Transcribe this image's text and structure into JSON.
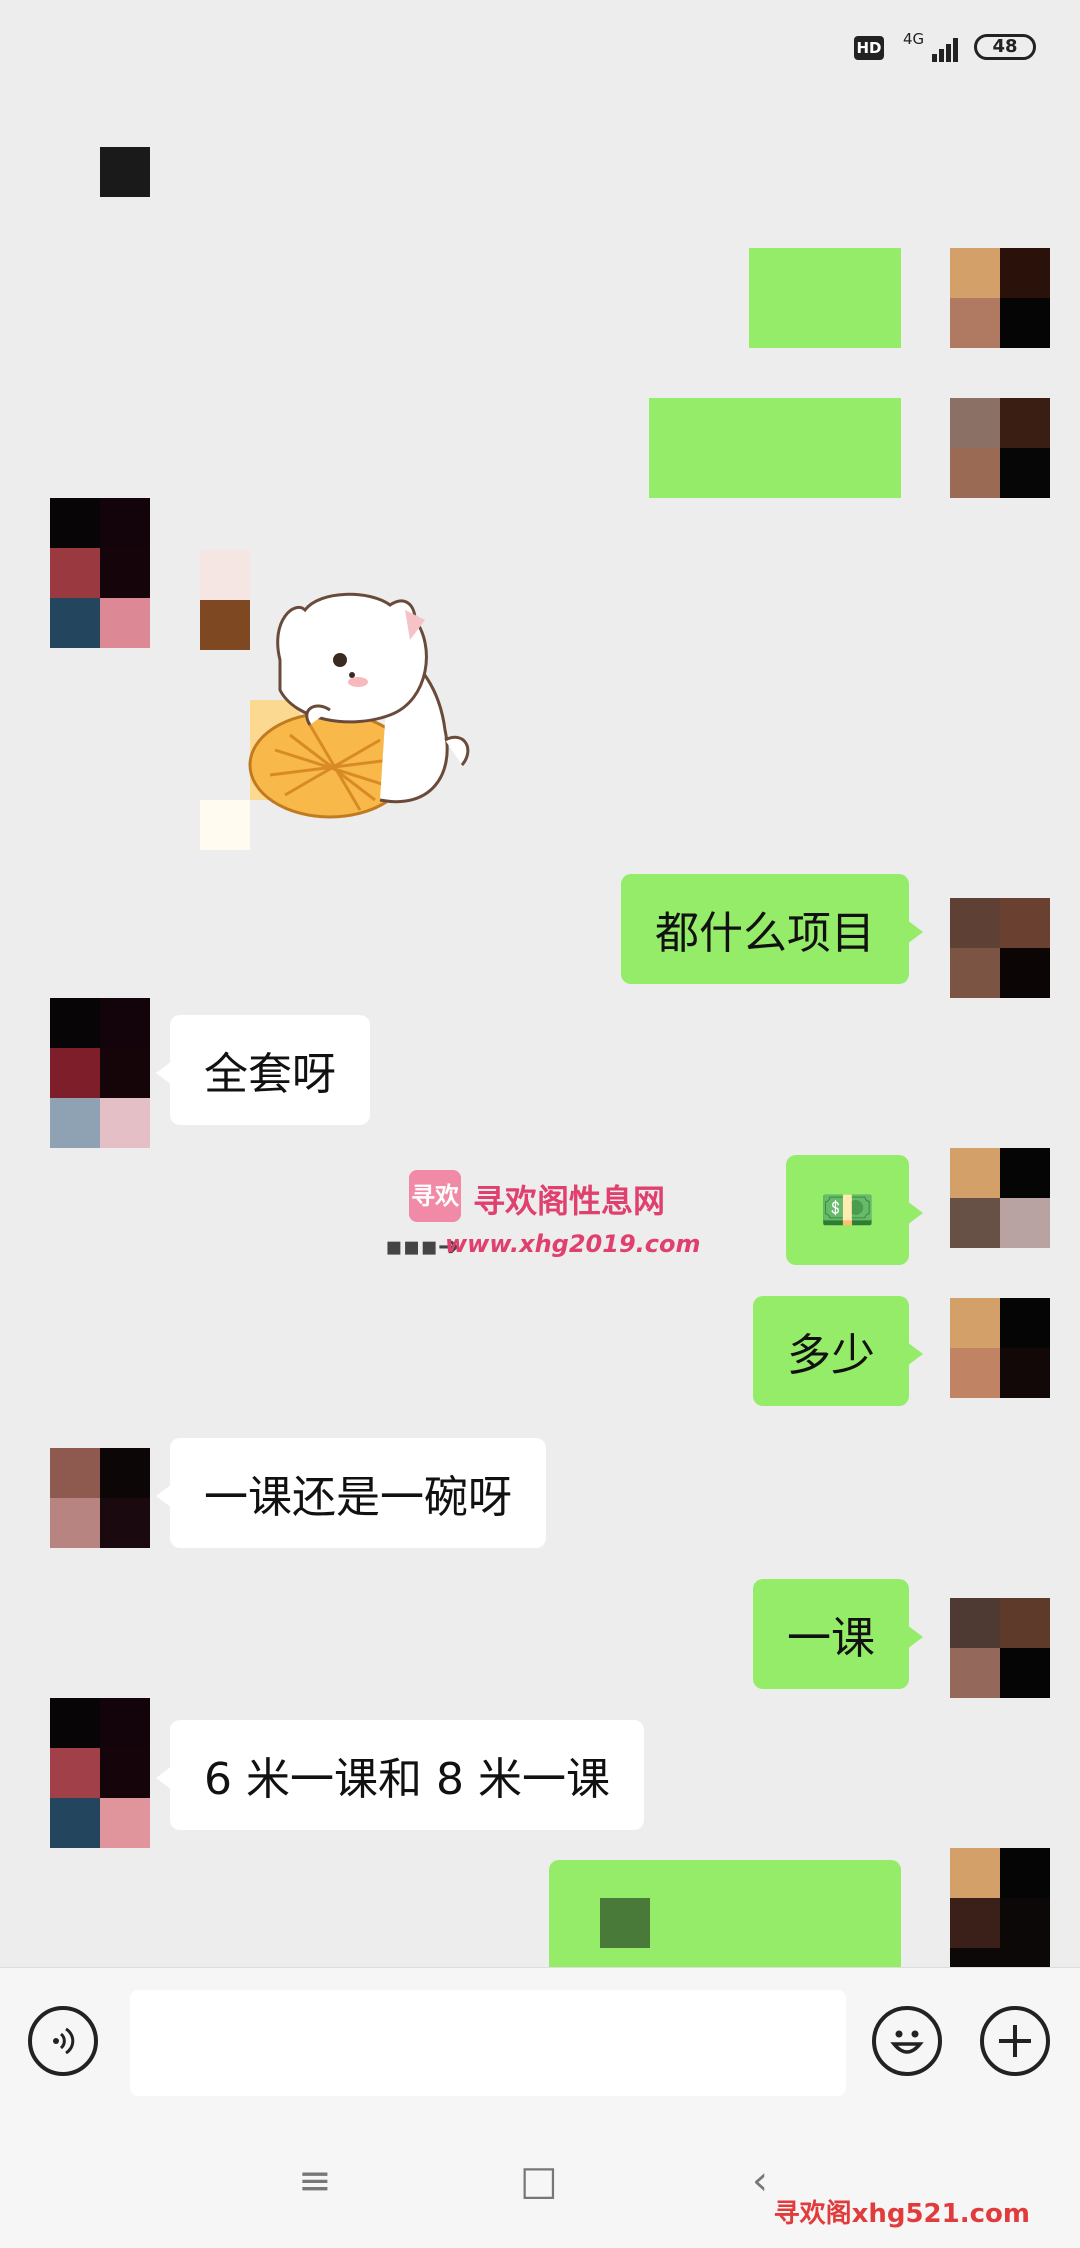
{
  "status_bar": {
    "hd": "HD",
    "network": "4G",
    "battery": "48"
  },
  "messages": {
    "m_projects": "都什么项目",
    "m_fullset": "全套呀",
    "m_money": "💵",
    "m_howmuch": "多少",
    "m_question": "一课还是一碗呀",
    "m_onelesson": "一课",
    "m_price": "6 米一课和 8 米一课"
  },
  "watermark": {
    "logo": "寻欢",
    "title": "寻欢阁性息网",
    "url": "www.xhg2019.com",
    "arrow": "▪▪▪➔"
  },
  "nav": {
    "menu": "≡",
    "home": "□",
    "back": "‹"
  },
  "corner_watermark": "寻欢阁xhg521.com",
  "icons": {
    "voice": "voice-icon",
    "emoji": "emoji-icon",
    "plus": "plus-icon"
  },
  "colors": {
    "my_bubble": "#95ec69",
    "other_bubble": "#ffffff",
    "background": "#ededed"
  }
}
